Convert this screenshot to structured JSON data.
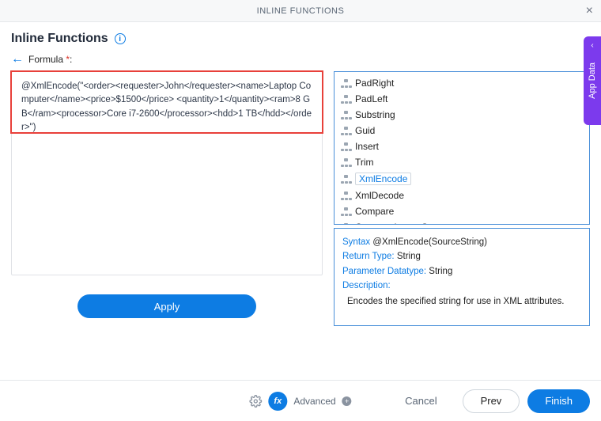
{
  "topbar": {
    "title": "INLINE FUNCTIONS"
  },
  "header": {
    "title": "Inline Functions"
  },
  "formula": {
    "label": "Formula ",
    "required": "*",
    "colon": ":",
    "value": "@XmlEncode(\"<order><requester>John</requester><name>Laptop Computer</name><price>$1500</price> <quantity>1</quantity><ram>8 GB</ram><processor>Core i7-2600</processor><hdd>1 TB</hdd></order>\")"
  },
  "apply_label": "Apply",
  "functions": [
    "PadRight",
    "PadLeft",
    "Substring",
    "Guid",
    "Insert",
    "Trim",
    "XmlEncode",
    "XmlDecode",
    "Compare",
    "CompareIgnoreCase"
  ],
  "selected_function_index": 6,
  "details": {
    "syntax_label": "Syntax",
    "syntax_value": " @XmlEncode(SourceString)",
    "return_label": "Return Type:",
    "return_value": " String",
    "param_label": "Parameter Datatype:",
    "param_value": " String",
    "desc_label": "Description:",
    "desc_value": "Encodes the specified string for use in XML attributes."
  },
  "sidetab": {
    "label": "App Data"
  },
  "footer": {
    "advanced": "Advanced",
    "cancel": "Cancel",
    "prev": "Prev",
    "finish": "Finish"
  }
}
